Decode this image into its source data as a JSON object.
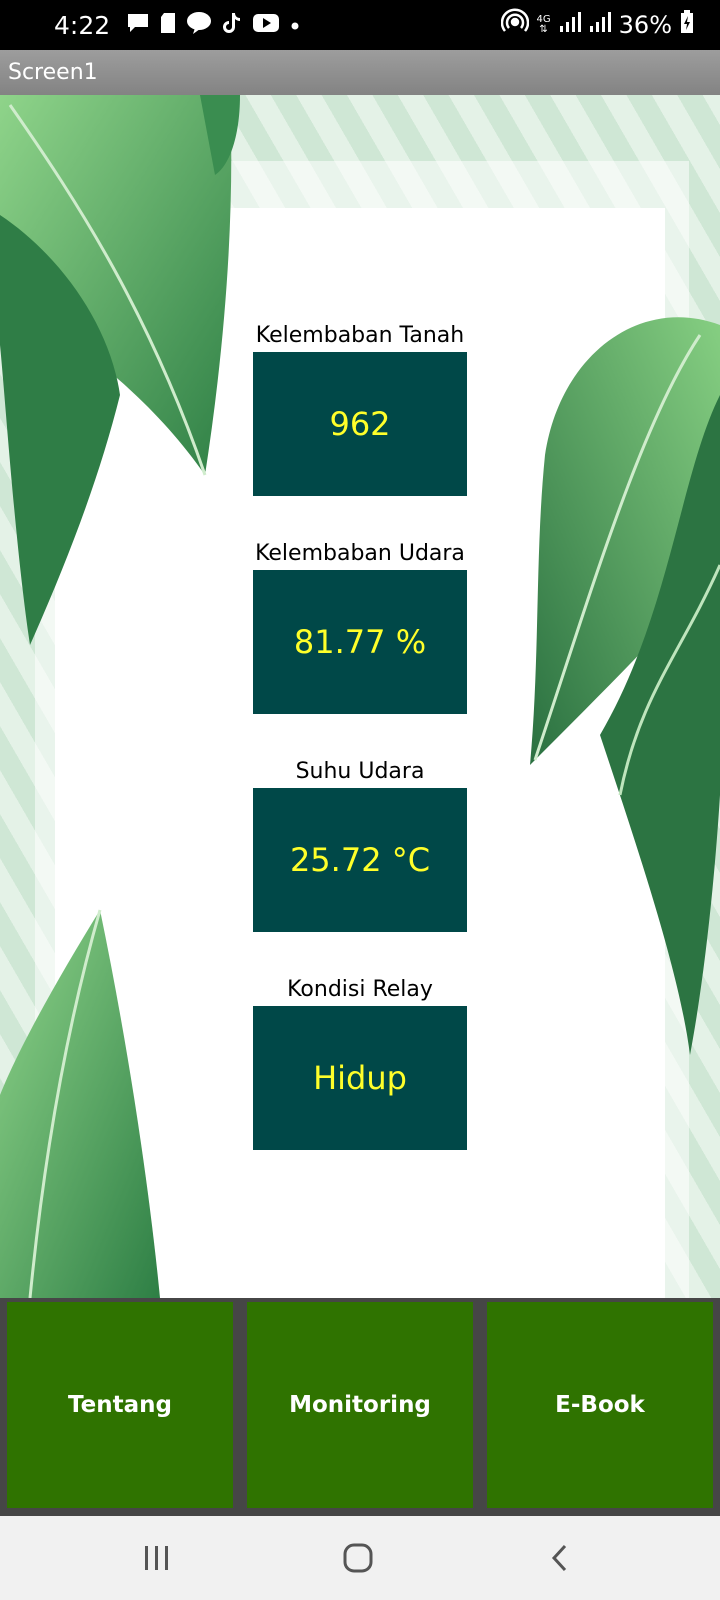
{
  "status_bar": {
    "time": "4:22",
    "network": "4G",
    "battery": "36%"
  },
  "app": {
    "title": "Screen1"
  },
  "readings": [
    {
      "label": "Kelembaban Tanah",
      "value": "962"
    },
    {
      "label": "Kelembaban Udara",
      "value": "81.77 %"
    },
    {
      "label": "Suhu Udara",
      "value": "25.72 °C"
    },
    {
      "label": "Kondisi Relay",
      "value": "Hidup"
    }
  ],
  "buttons": {
    "tentang": "Tentang",
    "monitoring": "Monitoring",
    "ebook": "E-Book"
  },
  "colors": {
    "value_box": "#004848",
    "value_text": "#ffff2a",
    "button": "#2f7300",
    "leaf": "#3f9a55"
  }
}
